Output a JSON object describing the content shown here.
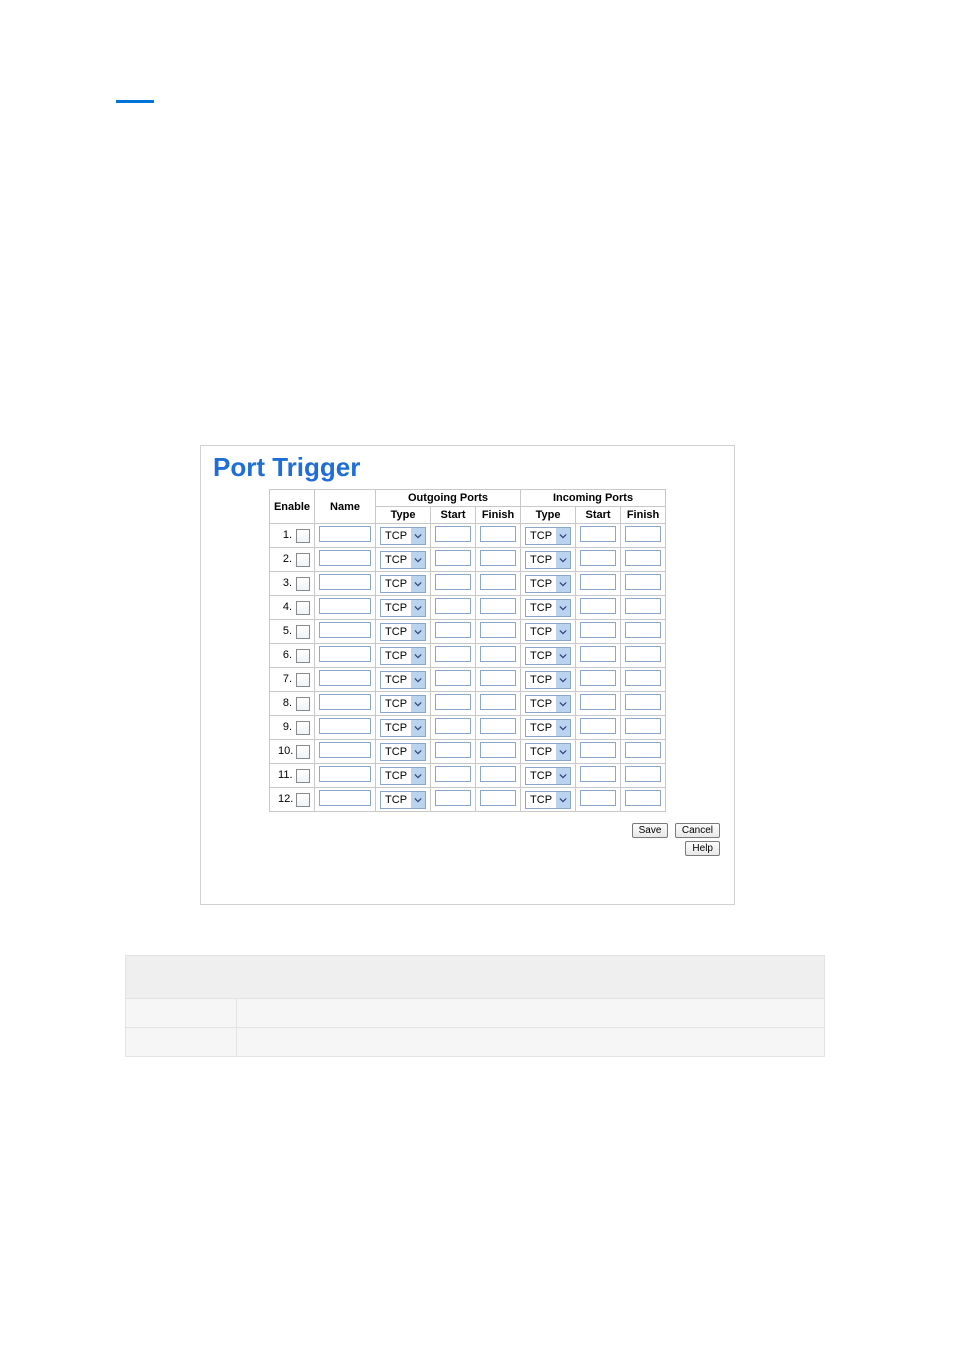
{
  "panel": {
    "title": "Port Trigger",
    "headers": {
      "enable": "Enable",
      "name": "Name",
      "outgoing": "Outgoing Ports",
      "incoming": "Incoming Ports",
      "type": "Type",
      "start": "Start",
      "finish": "Finish"
    },
    "rows": [
      {
        "num": "1.",
        "out_type": "TCP",
        "in_type": "TCP"
      },
      {
        "num": "2.",
        "out_type": "TCP",
        "in_type": "TCP"
      },
      {
        "num": "3.",
        "out_type": "TCP",
        "in_type": "TCP"
      },
      {
        "num": "4.",
        "out_type": "TCP",
        "in_type": "TCP"
      },
      {
        "num": "5.",
        "out_type": "TCP",
        "in_type": "TCP"
      },
      {
        "num": "6.",
        "out_type": "TCP",
        "in_type": "TCP"
      },
      {
        "num": "7.",
        "out_type": "TCP",
        "in_type": "TCP"
      },
      {
        "num": "8.",
        "out_type": "TCP",
        "in_type": "TCP"
      },
      {
        "num": "9.",
        "out_type": "TCP",
        "in_type": "TCP"
      },
      {
        "num": "10.",
        "out_type": "TCP",
        "in_type": "TCP"
      },
      {
        "num": "11.",
        "out_type": "TCP",
        "in_type": "TCP"
      },
      {
        "num": "12.",
        "out_type": "TCP",
        "in_type": "TCP"
      }
    ],
    "buttons": {
      "save": "Save",
      "cancel": "Cancel",
      "help": "Help"
    }
  },
  "doc_table": {
    "header": "",
    "rows": [
      {
        "c1": "",
        "c2": ""
      },
      {
        "c1": "",
        "c2": ""
      }
    ]
  }
}
